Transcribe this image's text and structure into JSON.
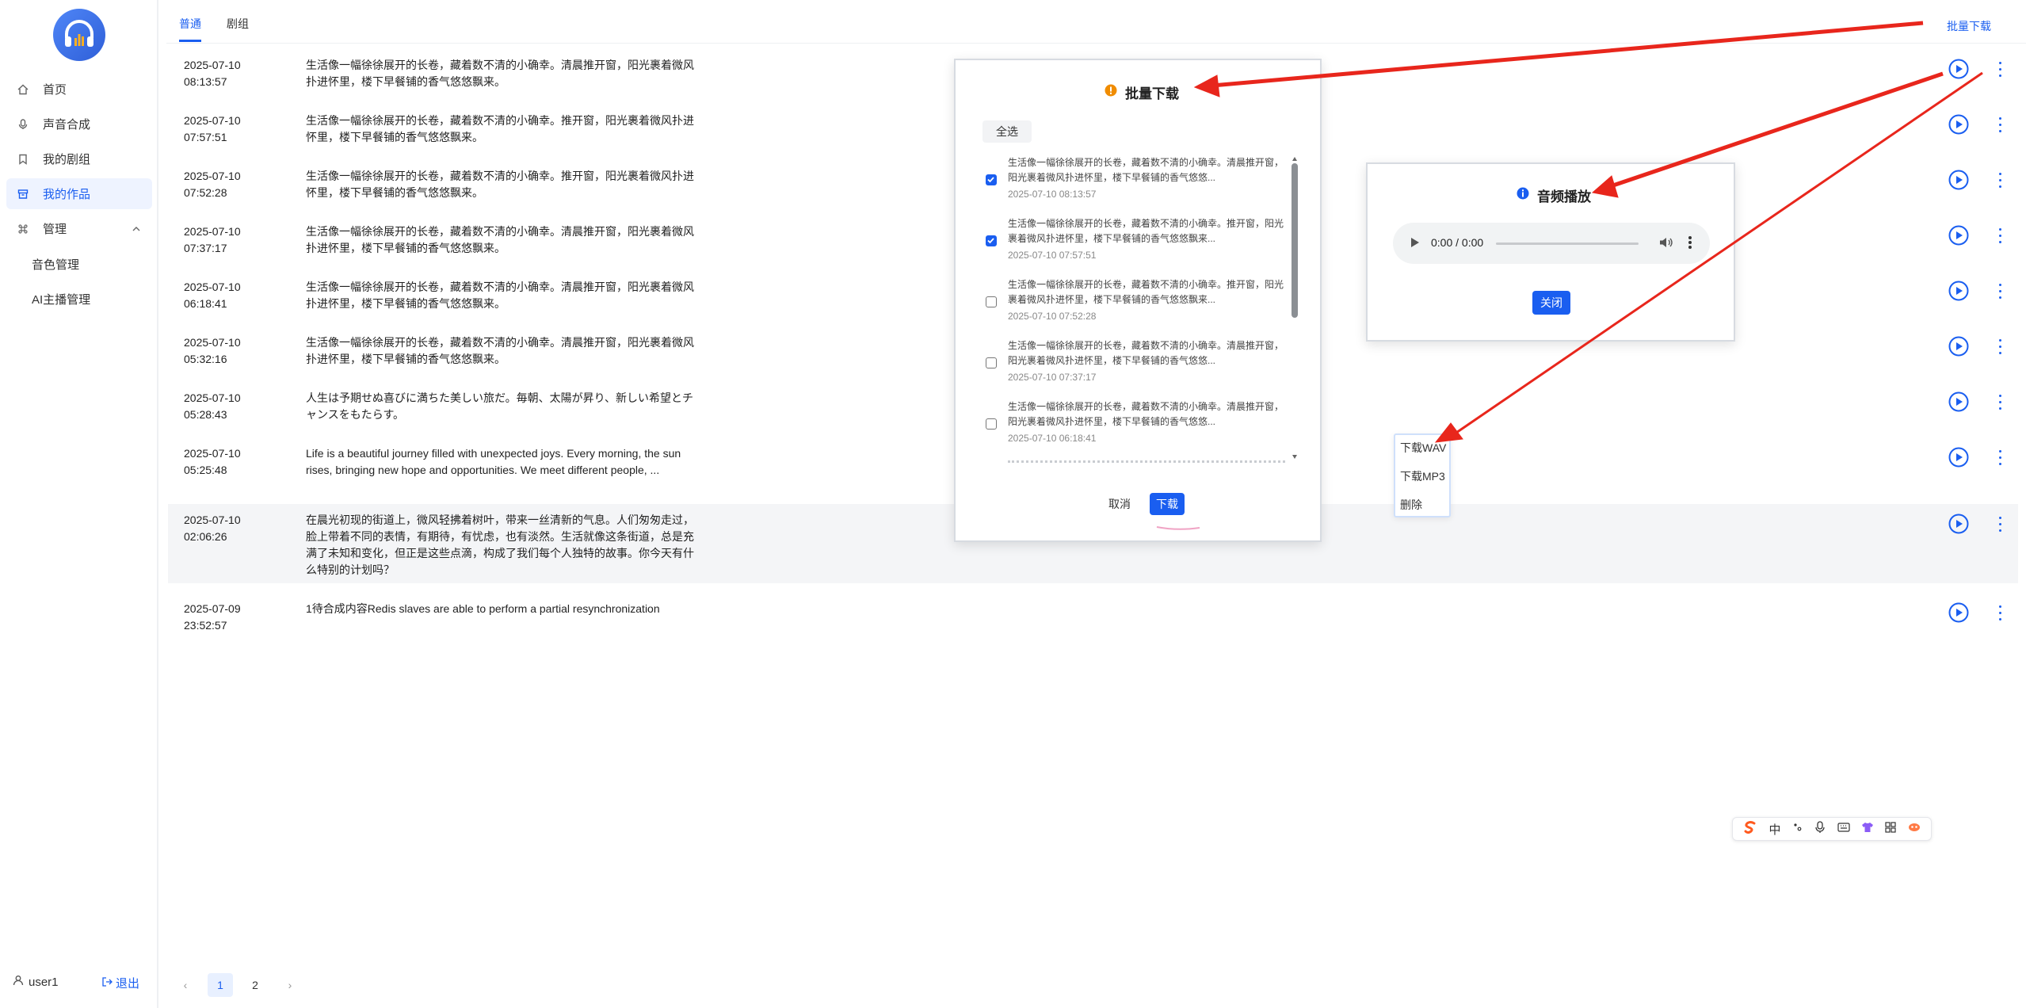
{
  "sidebar": {
    "nav": [
      {
        "label": "首页",
        "icon": "home-icon"
      },
      {
        "label": "声音合成",
        "icon": "microphone-icon"
      },
      {
        "label": "我的剧组",
        "icon": "bookmark-icon"
      },
      {
        "label": "我的作品",
        "icon": "archive-icon",
        "active": true
      },
      {
        "label": "管理",
        "icon": "command-icon"
      }
    ],
    "sub": [
      "音色管理",
      "AI主播管理"
    ],
    "user": "user1",
    "logout": "退出"
  },
  "tabs": [
    "普通",
    "剧组"
  ],
  "top_action": "批量下载",
  "rows": [
    {
      "date": "2025-07-10",
      "time": "08:13:57",
      "text": "生活像一幅徐徐展开的长卷，藏着数不清的小确幸。清晨推开窗，阳光裹着微风扑进怀里，楼下早餐铺的香气悠悠飘来。"
    },
    {
      "date": "2025-07-10",
      "time": "07:57:51",
      "text": "生活像一幅徐徐展开的长卷，藏着数不清的小确幸。推开窗，阳光裹着微风扑进怀里，楼下早餐铺的香气悠悠飘来。"
    },
    {
      "date": "2025-07-10",
      "time": "07:52:28",
      "text": "生活像一幅徐徐展开的长卷，藏着数不清的小确幸。推开窗，阳光裹着微风扑进怀里，楼下早餐铺的香气悠悠飘来。"
    },
    {
      "date": "2025-07-10",
      "time": "07:37:17",
      "text": "生活像一幅徐徐展开的长卷，藏着数不清的小确幸。清晨推开窗，阳光裹着微风扑进怀里，楼下早餐铺的香气悠悠飘来。"
    },
    {
      "date": "2025-07-10",
      "time": "06:18:41",
      "text": "生活像一幅徐徐展开的长卷，藏着数不清的小确幸。清晨推开窗，阳光裹着微风扑进怀里，楼下早餐铺的香气悠悠飘来。"
    },
    {
      "date": "2025-07-10",
      "time": "05:32:16",
      "text": "生活像一幅徐徐展开的长卷，藏着数不清的小确幸。清晨推开窗，阳光裹着微风扑进怀里，楼下早餐铺的香气悠悠飘来。"
    },
    {
      "date": "2025-07-10",
      "time": "05:28:43",
      "text": "人生は予期せぬ喜びに満ちた美しい旅だ。毎朝、太陽が昇り、新しい希望とチャンスをもたらす。"
    },
    {
      "date": "2025-07-10",
      "time": "05:25:48",
      "text": "Life is a beautiful journey filled with unexpected joys. Every morning, the sun rises, bringing new hope and opportunities. We meet different people, ..."
    },
    {
      "date": "2025-07-10",
      "time": "02:06:26",
      "text": "在晨光初现的街道上，微风轻拂着树叶，带来一丝清新的气息。人们匆匆走过，脸上带着不同的表情，有期待，有忧虑，也有淡然。生活就像这条街道，总是充满了未知和变化，但正是这些点滴，构成了我们每个人独特的故事。你今天有什么特别的计划吗？"
    },
    {
      "date": "2025-07-09",
      "time": "23:52:57",
      "text": "1待合成内容Redis slaves are able to perform a partial resynchronization"
    }
  ],
  "pagination": {
    "pages": [
      "1",
      "2"
    ],
    "current": "1",
    "prev": "‹",
    "next": "›"
  },
  "batch_modal": {
    "title": "批量下载",
    "select_all": "全选",
    "items": [
      {
        "text": "生活像一幅徐徐展开的长卷，藏着数不清的小确幸。清晨推开窗，阳光裹着微风扑进怀里，楼下早餐铺的香气悠悠...",
        "date": "2025-07-10 08:13:57",
        "checked": true
      },
      {
        "text": "生活像一幅徐徐展开的长卷，藏着数不清的小确幸。推开窗，阳光裹着微风扑进怀里，楼下早餐铺的香气悠悠飘来...",
        "date": "2025-07-10 07:57:51",
        "checked": true
      },
      {
        "text": "生活像一幅徐徐展开的长卷，藏着数不清的小确幸。推开窗，阳光裹着微风扑进怀里，楼下早餐铺的香气悠悠飘来...",
        "date": "2025-07-10 07:52:28",
        "checked": false
      },
      {
        "text": "生活像一幅徐徐展开的长卷，藏着数不清的小确幸。清晨推开窗，阳光裹着微风扑进怀里，楼下早餐铺的香气悠悠...",
        "date": "2025-07-10 07:37:17",
        "checked": false
      },
      {
        "text": "生活像一幅徐徐展开的长卷，藏着数不清的小确幸。清晨推开窗，阳光裹着微风扑进怀里，楼下早餐铺的香气悠悠...",
        "date": "2025-07-10 06:18:41",
        "checked": false
      }
    ],
    "cancel": "取消",
    "confirm": "下载"
  },
  "audio_modal": {
    "title": "音频播放",
    "time": "0:00 / 0:00",
    "close": "关闭"
  },
  "context_menu": [
    "下载WAV",
    "下载MP3",
    "删除"
  ],
  "ime_toolbar": {
    "lang": "中"
  },
  "colors": {
    "accent": "#1a5ef0",
    "annotation_arrow": "#e8261c",
    "warning": "#f08c00",
    "highlight_row": "#f4f5f7"
  }
}
